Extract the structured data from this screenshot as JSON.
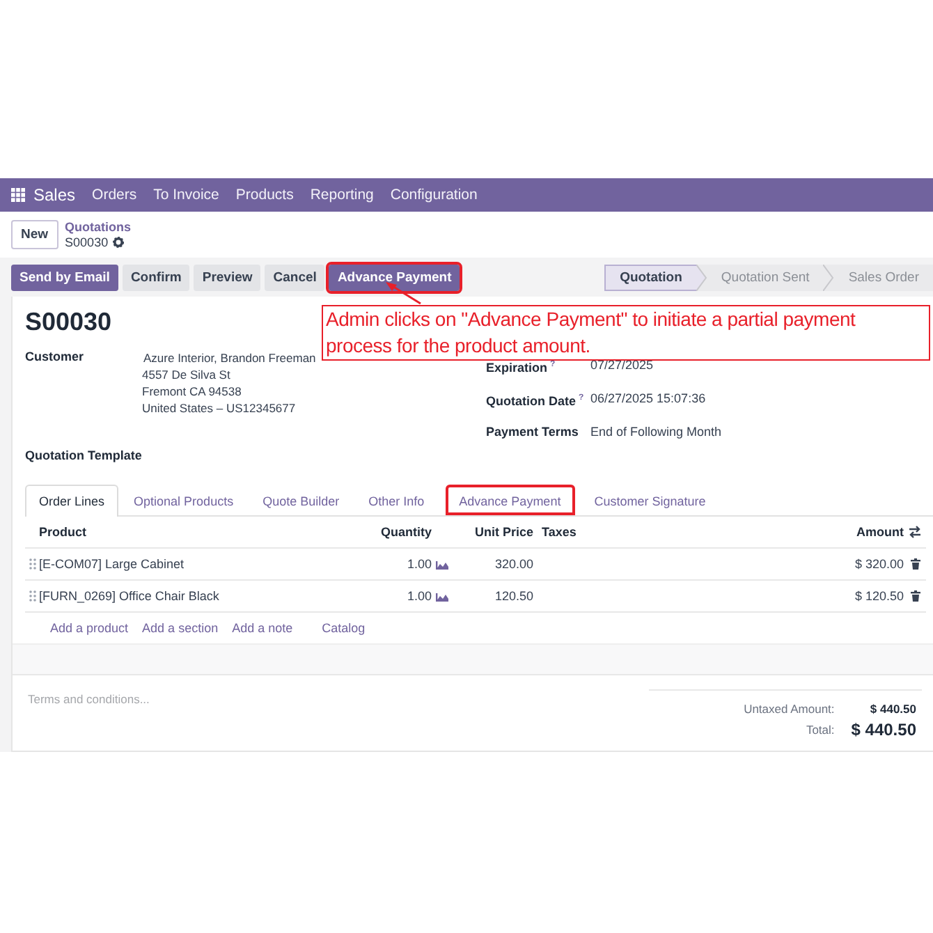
{
  "app": {
    "name": "Sales"
  },
  "menu": [
    "Orders",
    "To Invoice",
    "Products",
    "Reporting",
    "Configuration"
  ],
  "breadcrumb": {
    "new_button": "New",
    "parent": "Quotations",
    "current": "S00030"
  },
  "actions": [
    {
      "label": "Send by Email",
      "kind": "primary",
      "highlighted": false
    },
    {
      "label": "Confirm",
      "kind": "secondary",
      "highlighted": false
    },
    {
      "label": "Preview",
      "kind": "secondary",
      "highlighted": false
    },
    {
      "label": "Cancel",
      "kind": "secondary",
      "highlighted": false
    },
    {
      "label": "Advance Payment",
      "kind": "primary",
      "highlighted": true
    }
  ],
  "stages": [
    {
      "label": "Quotation",
      "selected": true
    },
    {
      "label": "Quotation Sent",
      "selected": false
    },
    {
      "label": "Sales Order",
      "selected": false
    }
  ],
  "annotation": {
    "text": "Admin clicks on \"Advance Payment\" to initiate a partial payment process for the product amount."
  },
  "form": {
    "title": "S00030",
    "left_fields": [
      {
        "label": "Customer",
        "lines": [
          "Azure Interior, Brandon Freeman",
          "4557 De Silva St",
          "Fremont CA 94538",
          "United States – US12345677"
        ]
      },
      {
        "label": "Quotation Template"
      }
    ],
    "right_fields": [
      {
        "label": "Expiration",
        "help": "?",
        "value": "07/27/2025"
      },
      {
        "label": "Quotation Date",
        "help": "?",
        "value": "06/27/2025 15:07:36"
      },
      {
        "label": "Payment Terms",
        "value": "End of Following Month"
      }
    ]
  },
  "tabs": [
    {
      "label": "Order Lines",
      "selected": true,
      "highlighted": false
    },
    {
      "label": "Optional Products",
      "selected": false,
      "highlighted": false
    },
    {
      "label": "Quote Builder",
      "selected": false,
      "highlighted": false
    },
    {
      "label": "Other Info",
      "selected": false,
      "highlighted": false
    },
    {
      "label": "Advance Payment",
      "selected": false,
      "highlighted": true
    },
    {
      "label": "Customer Signature",
      "selected": false,
      "highlighted": false
    }
  ],
  "table": {
    "columns": [
      "Product",
      "Quantity",
      "Unit Price",
      "Taxes",
      "Amount"
    ],
    "rows": [
      {
        "product": "[E-COM07] Large Cabinet",
        "quantity": "1.00",
        "unit_price": "320.00",
        "amount": "$ 320.00"
      },
      {
        "product": "[FURN_0269] Office Chair Black",
        "quantity": "1.00",
        "unit_price": "120.50",
        "amount": "$ 120.50"
      }
    ],
    "add_links": [
      "Add a product",
      "Add a section",
      "Add a note",
      "Catalog"
    ]
  },
  "terms": {
    "placeholder": "Terms and conditions..."
  },
  "totals": [
    {
      "label": "Untaxed Amount:",
      "value": "$ 440.50",
      "kind": "subtotal"
    },
    {
      "label": "Total:",
      "value": "$ 440.50",
      "kind": "total"
    }
  ]
}
